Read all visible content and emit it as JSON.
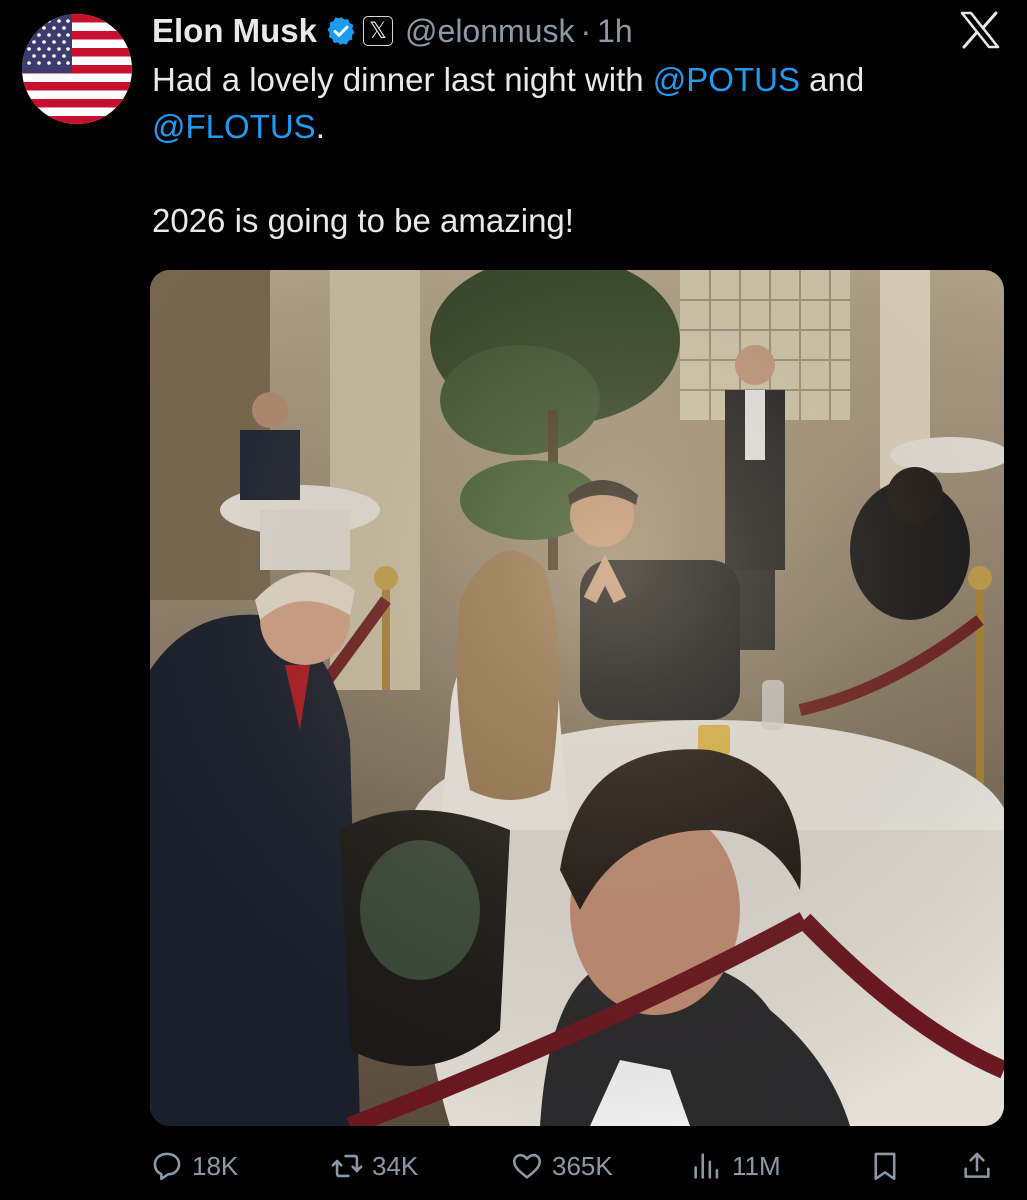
{
  "tweet": {
    "author_name": "Elon Musk",
    "handle": "@elonmusk",
    "separator": "·",
    "time": "1h",
    "affiliate_badge": "𝕏",
    "text_before_potus": "Had a lovely dinner last night with ",
    "mention_potus": "@POTUS",
    "text_between": " and",
    "mention_flotus": "@FLOTUS",
    "text_after_flotus": ".",
    "second_line": "2026 is going to be amazing!"
  },
  "actions": {
    "replies": "18K",
    "reposts": "34K",
    "likes": "365K",
    "views": "11M"
  },
  "icons": {
    "avatar": "us-flag-avatar",
    "verified": "verified-badge-icon",
    "brand": "x-logo-icon",
    "reply": "reply-icon",
    "repost": "repost-icon",
    "like": "heart-icon",
    "views": "views-icon",
    "bookmark": "bookmark-icon",
    "share": "share-icon"
  },
  "colors": {
    "background": "#000000",
    "text": "#e7e9ea",
    "secondary": "#8b98a5",
    "link": "#1d9bf0"
  }
}
